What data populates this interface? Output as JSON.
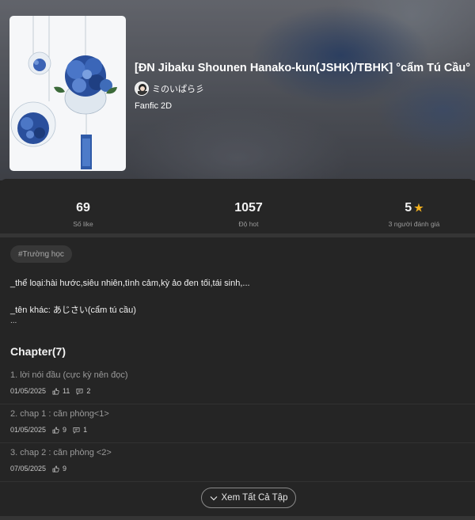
{
  "story": {
    "title": "[ĐN Jibaku Shounen Hanako-kun(JSHK)/TBHK] °cẩm Tú Cầu°",
    "author": "ミのいぱら彡",
    "genre": "Fanfic 2D",
    "cover_icon": "hydrangea-cover-image"
  },
  "stats": [
    {
      "value": "69",
      "label": "Số like"
    },
    {
      "value": "1057",
      "label": "Độ hot"
    },
    {
      "value": "5",
      "label": "3 người đánh giá",
      "icon": "star-icon"
    }
  ],
  "tag": "#Trường học",
  "description": {
    "line1": "_thể loại:hài hước,siêu nhiên,tình cảm,kỳ ảo đen tối,tái sinh,...",
    "line2": "_tên khác: あじさい(cẩm tú cầu)",
    "line3": "..."
  },
  "chapters_heading": "Chapter(7)",
  "chapters": [
    {
      "title": "1. lời nói đầu (cực kỳ nên đọc)",
      "date": "01/05/2025",
      "likes": "11",
      "comments": "2"
    },
    {
      "title": "2. chap 1 : căn phòng<1>",
      "date": "01/05/2025",
      "likes": "9",
      "comments": "1"
    },
    {
      "title": "3. chap 2 : căn phòng <2>",
      "date": "07/05/2025",
      "likes": "9",
      "comments": null
    }
  ],
  "see_all_label": "Xem Tất Cả Tập",
  "colors": {
    "star": "#f2b01e",
    "background": "#252525"
  }
}
